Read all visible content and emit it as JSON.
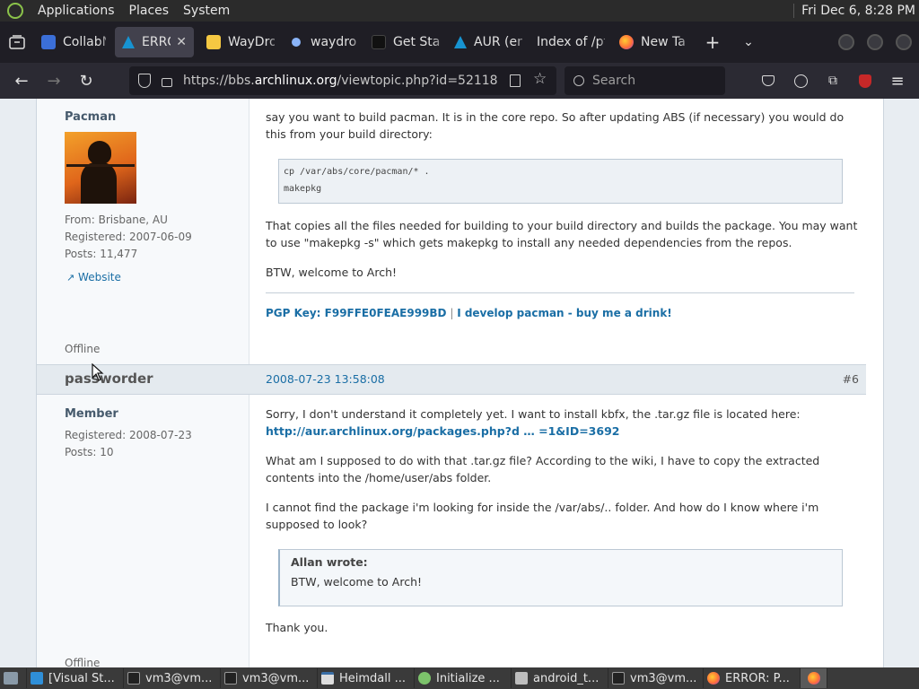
{
  "system_panel": {
    "menu": [
      "Applications",
      "Places",
      "System"
    ],
    "clock": "Fri Dec  6,  8:28 PM"
  },
  "tabs": [
    {
      "label": "CollabN",
      "icon": "collab-icon",
      "color": "#3b6fd8"
    },
    {
      "label": "ERROR",
      "icon": "arch-icon",
      "color": "#1793d1",
      "active": true
    },
    {
      "label": "WayDro",
      "icon": "waydroid-icon",
      "color": "#f5c842"
    },
    {
      "label": "waydroi",
      "icon": "dot-icon",
      "color": "#8ab4f8"
    },
    {
      "label": "Get Star",
      "icon": "github-icon",
      "color": "#111111"
    },
    {
      "label": "AUR (en",
      "icon": "arch-icon",
      "color": "#1793d1"
    },
    {
      "label": "Index of /pf",
      "icon": "blank-icon",
      "color": "#1f1e25"
    },
    {
      "label": "New Ta",
      "icon": "firefox-icon",
      "color": "#ff7139"
    }
  ],
  "navbar": {
    "url_prefix": "https://bbs.",
    "url_host": "archlinux.org",
    "url_path": "/viewtopic.php?id=52118",
    "search_placeholder": "Search"
  },
  "post1": {
    "author": "Pacman",
    "from": "From: Brisbane, AU",
    "registered": "Registered: 2007-06-09",
    "posts": "Posts: 11,477",
    "website": "Website",
    "status": "Offline",
    "text1": "say you want to build pacman.  It is in the core repo.  So after updating ABS (if necessary) you would do this from your build directory:",
    "code_line1": "cp /var/abs/core/pacman/* .",
    "code_line2": "makepkg",
    "text2": "That copies all the files needed for building to your build directory and builds the package.  You may want to use \"makepkg -s\" which gets makepkg to install any needed dependencies from the repos.",
    "text3": "BTW, welcome to Arch!",
    "sig_link1": "PGP Key: F99FFE0FEAE999BD",
    "sig_sep": " | ",
    "sig_link2": "I develop pacman - buy me a drink!"
  },
  "post2": {
    "author": "passworder",
    "date": "2008-07-23 13:58:08",
    "number": "#6",
    "role": "Member",
    "registered": "Registered: 2008-07-23",
    "posts": "Posts: 10",
    "status": "Offline",
    "text1_start": "Sorry, I don't understand it completely yet. I want to install kbfx, the .tar.gz file is located here: ",
    "text1_link": "http://aur.archlinux.org/packages.php?d … =1&ID=3692",
    "text2": "What am I supposed to do with that .tar.gz file? According to the wiki, I have to copy the extracted contents into the /home/user/abs folder.",
    "text3": "I cannot find the package i'm looking for inside the /var/abs/.. folder. And how do I know where i'm supposed to look?",
    "quote_author": "Allan wrote:",
    "quote_text": "BTW, welcome to Arch!",
    "text4": "Thank you."
  },
  "taskbar": [
    {
      "label": "[Visual St...",
      "icon": "vscode-icon",
      "color": "#2f8fd8"
    },
    {
      "label": "vm3@vm...",
      "icon": "terminal-icon",
      "color": "#777777"
    },
    {
      "label": "vm3@vm...",
      "icon": "terminal-icon",
      "color": "#777777"
    },
    {
      "label": "Heimdall ...",
      "icon": "window-icon",
      "color": "#dddddd"
    },
    {
      "label": "Initialize ...",
      "icon": "android-icon",
      "color": "#7cc36b"
    },
    {
      "label": "android_t...",
      "icon": "folder-icon",
      "color": "#bdbdbd"
    },
    {
      "label": "vm3@vm...",
      "icon": "terminal-icon",
      "color": "#777777"
    },
    {
      "label": "ERROR: P...",
      "icon": "firefox-icon",
      "color": "#ff7139"
    },
    {
      "label": "",
      "icon": "firefox-icon",
      "color": "#ff7139",
      "active": true
    }
  ]
}
